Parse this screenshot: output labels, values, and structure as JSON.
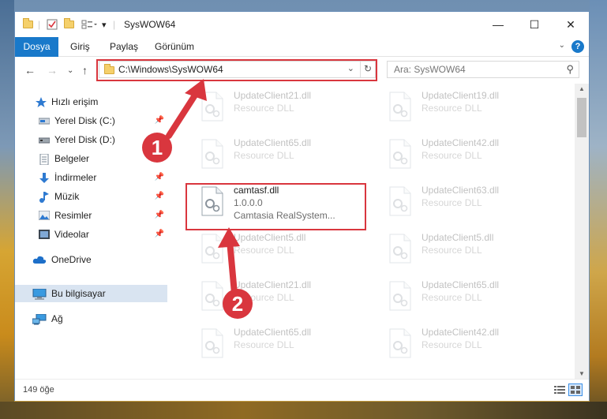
{
  "window": {
    "title": "SysWOW64",
    "minimize": "—",
    "maximize": "☐",
    "close": "✕"
  },
  "ribbon": {
    "tabs": [
      "Dosya",
      "Giriş",
      "Paylaş",
      "Görünüm"
    ],
    "help": "?"
  },
  "nav": {
    "address": "C:\\Windows\\SysWOW64",
    "search_placeholder": "Ara: SysWOW64"
  },
  "sidebar": {
    "items": [
      {
        "label": "Hızlı erişim",
        "icon": "star-icon"
      },
      {
        "label": "Yerel Disk (C:)",
        "icon": "drive-icon",
        "pinned": true
      },
      {
        "label": "Yerel Disk (D:)",
        "icon": "drive-icon"
      },
      {
        "label": "Belgeler",
        "icon": "documents-icon",
        "pinned": true
      },
      {
        "label": "İndirmeler",
        "icon": "download-icon",
        "pinned": true
      },
      {
        "label": "Müzik",
        "icon": "music-icon",
        "pinned": true
      },
      {
        "label": "Resimler",
        "icon": "pictures-icon",
        "pinned": true
      },
      {
        "label": "Videolar",
        "icon": "video-icon",
        "pinned": true
      },
      {
        "label": "OneDrive",
        "icon": "cloud-icon"
      },
      {
        "label": "Bu bilgisayar",
        "icon": "computer-icon",
        "selected": true
      },
      {
        "label": "Ağ",
        "icon": "network-icon"
      }
    ]
  },
  "files": {
    "left": [
      {
        "name": "UpdateClient21.dll",
        "type": "Resource DLL"
      },
      {
        "name": "UpdateClient65.dll",
        "type": "Resource DLL"
      },
      {
        "name": "camtasf.dll",
        "version": "1.0.0.0",
        "company": "Camtasia RealSystem...",
        "highlighted": true
      },
      {
        "name": "UpdateClient5.dll",
        "type": "Resource DLL"
      },
      {
        "name": "UpdateClient21.dll",
        "type": "Resource DLL"
      },
      {
        "name": "UpdateClient65.dll",
        "type": "Resource DLL"
      }
    ],
    "right": [
      {
        "name": "UpdateClient19.dll",
        "type": "Resource DLL"
      },
      {
        "name": "UpdateClient42.dll",
        "type": "Resource DLL"
      },
      {
        "name": "UpdateClient63.dll",
        "type": "Resource DLL"
      },
      {
        "name": "UpdateClient5.dll",
        "type": "Resource DLL"
      },
      {
        "name": "UpdateClient65.dll",
        "type": "Resource DLL"
      },
      {
        "name": "UpdateClient42.dll",
        "type": "Resource DLL"
      }
    ]
  },
  "status": {
    "count": "149 öğe"
  },
  "annotations": {
    "step1": "1",
    "step2": "2",
    "color": "#d9363e"
  }
}
